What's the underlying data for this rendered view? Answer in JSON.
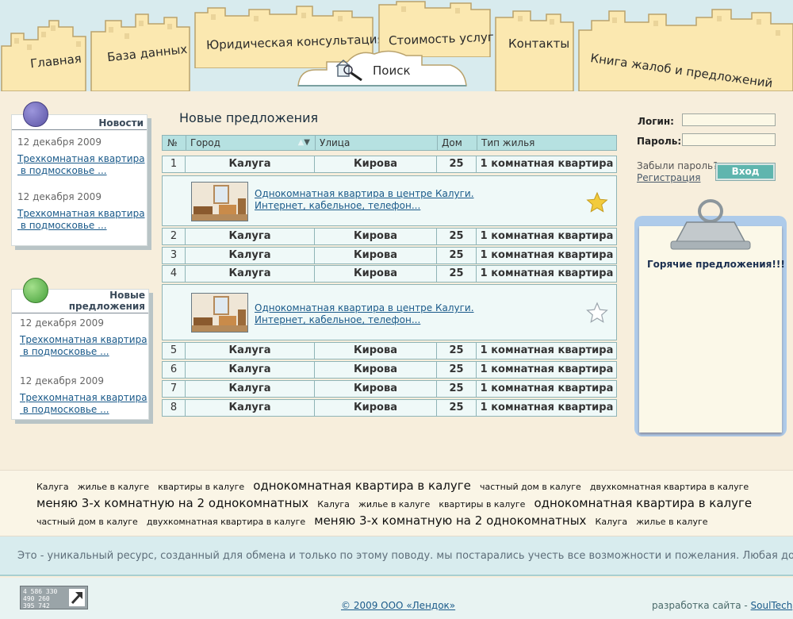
{
  "nav": {
    "tabs": [
      {
        "label": "Главная"
      },
      {
        "label": "База данных"
      },
      {
        "label": "Юридическая консультация"
      },
      {
        "label": "Стоимость услуг"
      },
      {
        "label": "Контакты"
      },
      {
        "label": "Книга жалоб и предложений"
      }
    ],
    "search_label": "Поиск"
  },
  "news": {
    "title": "Новости",
    "items": [
      {
        "date": "12 декабря 2009",
        "line1": "Трехкомнатная квартира",
        "line2": "в подмосковье ..."
      },
      {
        "date": "12 декабря 2009",
        "line1": "Трехкомнатная квартира",
        "line2": "в подмосковье ..."
      }
    ]
  },
  "offers": {
    "title_line1": "Новые",
    "title_line2": "предложения",
    "items": [
      {
        "date": "12 декабря 2009",
        "line1": "Трехкомнатная квартира",
        "line2": "в подмосковье ..."
      },
      {
        "date": "12 декабря 2009",
        "line1": "Трехкомнатная квартира",
        "line2": "в подмосковье ..."
      }
    ]
  },
  "listings": {
    "title": "Новые предложения",
    "columns": [
      "№",
      "Город",
      "Улица",
      "Дом",
      "Тип жилья"
    ],
    "sort_icon": "sort-arrows-icon",
    "rows": [
      {
        "num": "1",
        "city": "Калуга",
        "street": "Кирова",
        "house": "25",
        "type": "1 комнатная квартира"
      },
      {
        "num": "2",
        "city": "Калуга",
        "street": "Кирова",
        "house": "25",
        "type": "1 комнатная квартира"
      },
      {
        "num": "3",
        "city": "Калуга",
        "street": "Кирова",
        "house": "25",
        "type": "1 комнатная квартира"
      },
      {
        "num": "4",
        "city": "Калуга",
        "street": "Кирова",
        "house": "25",
        "type": "1 комнатная квартира"
      },
      {
        "num": "5",
        "city": "Калуга",
        "street": "Кирова",
        "house": "25",
        "type": "1 комнатная квартира"
      },
      {
        "num": "6",
        "city": "Калуга",
        "street": "Кирова",
        "house": "25",
        "type": "1 комнатная квартира"
      },
      {
        "num": "7",
        "city": "Калуга",
        "street": "Кирова",
        "house": "25",
        "type": "1 комнатная квартира"
      },
      {
        "num": "8",
        "city": "Калуга",
        "street": "Кирова",
        "house": "25",
        "type": "1 комнатная квартира"
      }
    ],
    "details": [
      {
        "after_row": "1",
        "line1": "Однокомнатная квартира в центре Калуги.",
        "line2": "Интернет, кабельное, телефон...",
        "starred": true
      },
      {
        "after_row": "4",
        "line1": "Однокомнатная квартира в центре Калуги.",
        "line2": "Интернет, кабельное, телефон...",
        "starred": false
      }
    ]
  },
  "login": {
    "login_label": "Логин:",
    "password_label": "Пароль:",
    "forgot": "Забыли пароль?",
    "register": "Регистрация",
    "button": "Вход"
  },
  "hot": {
    "title": "Горячие предложения!!!"
  },
  "tag_cloud": {
    "lines": [
      [
        {
          "text": "Калуга",
          "size": "s"
        },
        {
          "text": "жилье в калуге",
          "size": "s"
        },
        {
          "text": "квартиры в калуге",
          "size": "s"
        },
        {
          "text": "однокомнатная квартира в калуге",
          "size": "l"
        },
        {
          "text": "частный дом в калуге",
          "size": "s"
        },
        {
          "text": "двухкомнатная квартира в калуге",
          "size": "s"
        }
      ],
      [
        {
          "text": "меняю 3-х комнатную на 2 однокомнатных",
          "size": "l"
        },
        {
          "text": "Калуга",
          "size": "s"
        },
        {
          "text": "жилье в калуге",
          "size": "s"
        },
        {
          "text": "квартиры в калуге",
          "size": "s"
        },
        {
          "text": "однокомнатная квартира в калуге",
          "size": "l"
        }
      ],
      [
        {
          "text": "частный дом в калуге",
          "size": "s"
        },
        {
          "text": "двухкомнатная квартира в калуге",
          "size": "s"
        },
        {
          "text": "меняю 3-х комнатную на 2 однокомнатных",
          "size": "l"
        },
        {
          "text": "Калуга",
          "size": "s"
        },
        {
          "text": "жилье в калуге",
          "size": "s"
        }
      ]
    ]
  },
  "ticker": "Это - уникальный ресурс, созданный для обмена и только по этому поводу. мы постарались учесть все возможности и пожелания. Любая доп",
  "footer": {
    "counter_lines": [
      "4 586 330",
      "490 260",
      "395 742"
    ],
    "copyright": "© 2009 ООО «Лендок»",
    "credits_prefix": "разработка сайта - ",
    "credits_link": "SoulTech"
  },
  "colors": {
    "header_bg": "#d8ebee",
    "building": "#fbe8b0",
    "table_header": "#b6e1e1",
    "button": "#5fb5ae",
    "star_gold": "#f2cb3c",
    "pin_blue": "#6b64b0",
    "pin_green": "#5cb84a"
  }
}
